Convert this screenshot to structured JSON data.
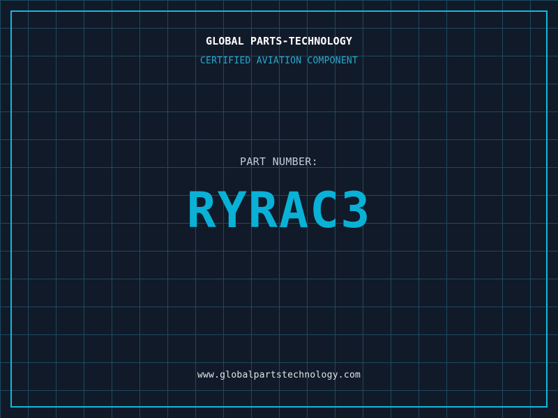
{
  "colors": {
    "background": "#111a29",
    "grid_line": "#1d4a5f",
    "frame_border": "#10bade",
    "header_text": "#ffffff",
    "tagline_text": "#2aa9cd",
    "part_label_text": "#c3ccd5",
    "part_number_text": "#09b1d6",
    "footer_text": "#dfe5e6"
  },
  "header": {
    "company_name": "GLOBAL PARTS-TECHNOLOGY",
    "tagline": "CERTIFIED AVIATION COMPONENT"
  },
  "part": {
    "label": "PART NUMBER:",
    "number": "RYRAC3"
  },
  "footer": {
    "website": "www.globalpartstechnology.com"
  }
}
